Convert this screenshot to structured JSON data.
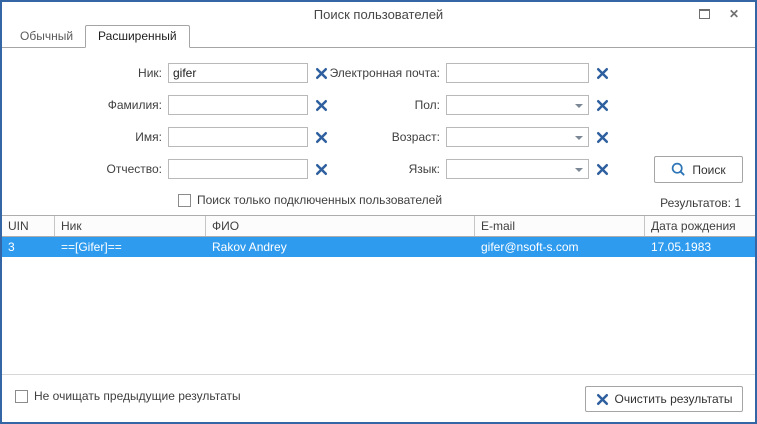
{
  "window": {
    "title": "Поиск пользователей"
  },
  "tabs": [
    {
      "label": "Обычный",
      "active": false
    },
    {
      "label": "Расширенный",
      "active": true
    }
  ],
  "form": {
    "fields_left": [
      {
        "label": "Ник:",
        "value": "gifer"
      },
      {
        "label": "Фамилия:",
        "value": ""
      },
      {
        "label": "Имя:",
        "value": ""
      },
      {
        "label": "Отчество:",
        "value": ""
      }
    ],
    "fields_right": [
      {
        "label": "Электронная почта:",
        "value": "",
        "type": "text"
      },
      {
        "label": "Пол:",
        "value": "",
        "type": "select"
      },
      {
        "label": "Возраст:",
        "value": "",
        "type": "select"
      },
      {
        "label": "Язык:",
        "value": "",
        "type": "select"
      }
    ],
    "search_button": "Поиск",
    "connected_only_checkbox": {
      "label": "Поиск только подключенных пользователей",
      "checked": false
    }
  },
  "results": {
    "count_label": "Результатов: 1",
    "table": {
      "columns": [
        "UIN",
        "Ник",
        "ФИО",
        "E-mail",
        "Дата рождения"
      ],
      "rows": [
        {
          "selected": true,
          "cells": [
            "3",
            "==[Gifer]==",
            "Rakov Andrey",
            "gifer@nsoft-s.com",
            "17.05.1983"
          ]
        }
      ]
    }
  },
  "footer": {
    "keep_results_checkbox": {
      "label": "Не очищать предыдущие результаты",
      "checked": false
    },
    "clear_button": "Очистить результаты"
  },
  "colors": {
    "window_border": "#3465a4",
    "selection_blue": "#2e9bef",
    "icon_blue": "#2e5f9e",
    "search_icon_blue": "#2e75b6"
  }
}
